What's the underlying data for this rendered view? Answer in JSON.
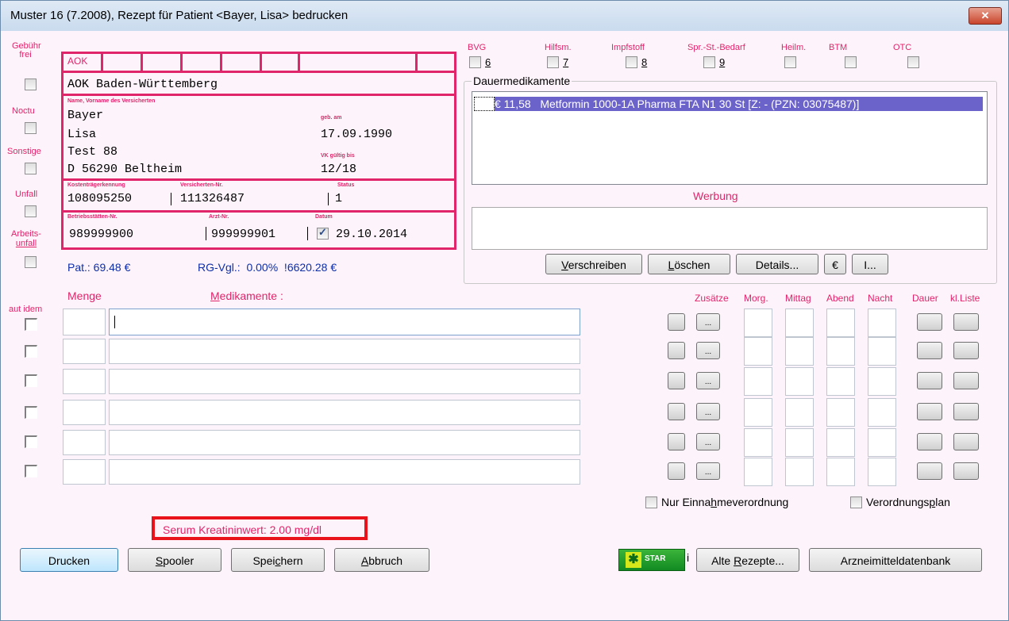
{
  "window": {
    "title": "Muster 16 (7.2008), Rezept für Patient <Bayer, Lisa> bedrucken",
    "close_icon": "close-icon"
  },
  "left_flags": {
    "gebuehr_frei_1": "Gebühr",
    "gebuehr_frei_2": "frei",
    "noctu": "Noctu",
    "sonstige": "Sonstige",
    "unfall": "Unfall",
    "arbeitsunfall_1": "Arbeits-",
    "arbeitsunfall_2": "unfall",
    "aut_idem": "aut idem"
  },
  "patient_form": {
    "kasse_short": "AOK",
    "kasse_name": "AOK Baden-Württemberg",
    "name_label": "Name, Vorname des Versicherten",
    "geb_label": "geb. am",
    "nachname": "Bayer",
    "vorname": "Lisa",
    "geburtsdatum": "17.09.1990",
    "strasse": "Test 88",
    "vk_label": "VK gültig bis",
    "ort": "D 56290 Beltheim",
    "vk_gueltig": "12/18",
    "kostentraeger_label": "Kostenträgerkennung",
    "versicherten_nr_label": "Versicherten-Nr.",
    "status_label": "Status",
    "kostentraeger": "108095250",
    "versicherten_nr": "111326487",
    "status": "1",
    "bsnr_label": "Betriebsstätten-Nr.",
    "arzt_nr_label": "Arzt-Nr.",
    "datum_label": "Datum",
    "bsnr": "989999900",
    "arzt_nr": "999999901",
    "datum": "29.10.2014",
    "datum_checked": true
  },
  "summary": {
    "pat": "Pat.: 69.48 €",
    "rg_vgl": "RG-Vgl.:  0.00%  !6620.28 €"
  },
  "categories": [
    {
      "label": "BVG",
      "num": "6"
    },
    {
      "label": "Hilfsm.",
      "num": "7"
    },
    {
      "label": "Impfstoff",
      "num": "8"
    },
    {
      "label": "Spr.-St.-Bedarf",
      "num": "9"
    },
    {
      "label": "Heilm.",
      "num": ""
    },
    {
      "label": "BTM",
      "num": ""
    },
    {
      "label": "OTC",
      "num": ""
    }
  ],
  "dauermedikamente": {
    "title": "Dauermedikamente",
    "items": [
      "€ 11,58   Metformin 1000-1A Pharma FTA N1 30 St [Z: - (PZN: 03075487)]"
    ],
    "werbung": "Werbung"
  },
  "med_buttons": {
    "verschreiben": "Verschreiben",
    "loeschen": "Löschen",
    "details": "Details...",
    "euro": "€",
    "info": "I..."
  },
  "grid_headers": {
    "menge": "Menge",
    "medikamente": "Medikamente :",
    "zusaetze": "Zusätze",
    "morg": "Morg.",
    "mittag": "Mittag",
    "abend": "Abend",
    "nacht": "Nacht",
    "dauer": "Dauer",
    "klliste": "kl.Liste"
  },
  "rows": [
    {
      "menge": "",
      "medikament": ""
    },
    {
      "menge": "",
      "medikament": ""
    },
    {
      "menge": "",
      "medikament": ""
    },
    {
      "menge": "",
      "medikament": ""
    },
    {
      "menge": "",
      "medikament": ""
    },
    {
      "menge": "",
      "medikament": ""
    }
  ],
  "options": {
    "nur_einnahme": "Nur Einnahmeverordnung",
    "verordnungsplan": "Verordnungsplan"
  },
  "warning": {
    "text": "Serum Kreatininwert: 2.00 mg/dl",
    "border_color": "#e8131b"
  },
  "bottom_buttons": {
    "drucken": "Drucken",
    "spooler": "Spooler",
    "speichern": "Speichern",
    "abbruch": "Abbruch",
    "star": "STAR",
    "star_info": "i",
    "alte_rezepte": "Alte Rezepte...",
    "arzneimitteldatenbank": "Arzneimitteldatenbank"
  },
  "colors": {
    "form_pink": "#e0256b",
    "selection_blue": "#6b63c9",
    "value_blue": "#0f2fa8"
  }
}
